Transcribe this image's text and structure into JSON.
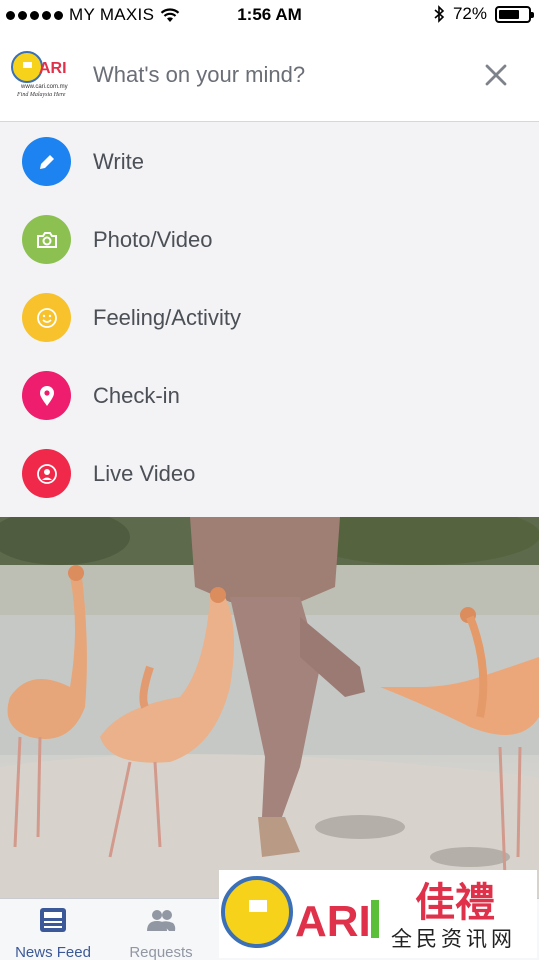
{
  "status_bar": {
    "carrier": "MY MAXIS",
    "time": "1:56 AM",
    "battery_percent": "72%",
    "battery_level": 0.72
  },
  "composer": {
    "placeholder": "What's on your mind?",
    "avatar_text": "ARI",
    "avatar_url_text": "www.cari.com.my",
    "avatar_tagline": "Find Malaysia Here"
  },
  "menu": {
    "items": [
      {
        "label": "Write",
        "icon": "pencil-icon",
        "color": "#1c83f0"
      },
      {
        "label": "Photo/Video",
        "icon": "camera-icon",
        "color": "#8cc152"
      },
      {
        "label": "Feeling/Activity",
        "icon": "smiley-icon",
        "color": "#f7c22b"
      },
      {
        "label": "Check-in",
        "icon": "map-pin-icon",
        "color": "#ee1d6d"
      },
      {
        "label": "Live Video",
        "icon": "live-broadcast-icon",
        "color": "#f0284a"
      }
    ]
  },
  "tab_bar": {
    "tabs": [
      {
        "label": "News Feed",
        "active": true,
        "color": "#3b5998"
      },
      {
        "label": "Requests",
        "active": false,
        "color": "#9197a3"
      }
    ]
  },
  "watermark": {
    "logo_text": "ARI",
    "chinese_title": "佳禮",
    "chinese_subtitle": "全民资讯网"
  }
}
